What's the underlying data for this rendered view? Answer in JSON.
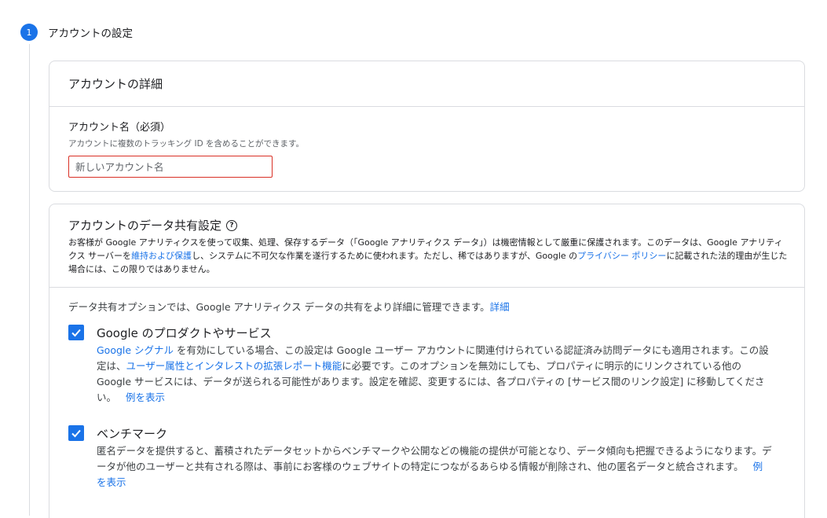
{
  "step": {
    "number": "1",
    "title": "アカウントの設定"
  },
  "account_details": {
    "heading": "アカウントの詳細",
    "name_label": "アカウント名（必須）",
    "name_help": "アカウントに複数のトラッキング ID を含めることができます。",
    "name_placeholder": "新しいアカウント名"
  },
  "data_sharing": {
    "heading": "アカウントのデータ共有設定",
    "help_icon": "question-icon",
    "desc_part1": "お客様が Google アナリティクスを使って収集、処理、保存するデータ（「Google アナリティクス データ」）は機密情報として厳重に保護されます。このデータは、Google アナリティクス サーバーを",
    "desc_link1": "維持および保護",
    "desc_part2": "し、システムに不可欠な作業を遂行するために使われます。ただし、稀ではありますが、Google の",
    "desc_link2": "プライバシー ポリシー",
    "desc_part3": "に記載された法的理由が生じた場合には、この限りではありません。",
    "intro_text": "データ共有オプションでは、Google アナリティクス データの共有をより詳細に管理できます。",
    "intro_link": "詳細",
    "options": [
      {
        "title": "Google のプロダクトやサービス",
        "checked": true,
        "desc_link1": "Google シグナル",
        "desc_part1": " を有効にしている場合、この設定は Google ユーザー アカウントに関連付けられている認証済み訪問データにも適用されます。この設定は、",
        "desc_link2": "ユーザー属性とインタレストの拡張レポート機能",
        "desc_part2": "に必要です。このオプションを無効にしても、プロパティに明示的にリンクされている他の Google サービスには、データが送られる可能性があります。設定を確認、変更するには、各プロパティの [サービス間のリンク設定] に移動してください。",
        "example_link": "例を表示"
      },
      {
        "title": "ベンチマーク",
        "checked": true,
        "desc_part1": "匿名データを提供すると、蓄積されたデータセットからベンチマークや公開などの機能の提供が可能となり、データ傾向も把握できるようになります。データが他のユーザーと共有される際は、事前にお客様のウェブサイトの特定につながるあらゆる情報が削除され、他の匿名データと統合されます。",
        "example_link": "例を表示"
      }
    ]
  },
  "colors": {
    "accent": "#1a73e8",
    "error": "#d93025",
    "border": "#dadce0"
  }
}
